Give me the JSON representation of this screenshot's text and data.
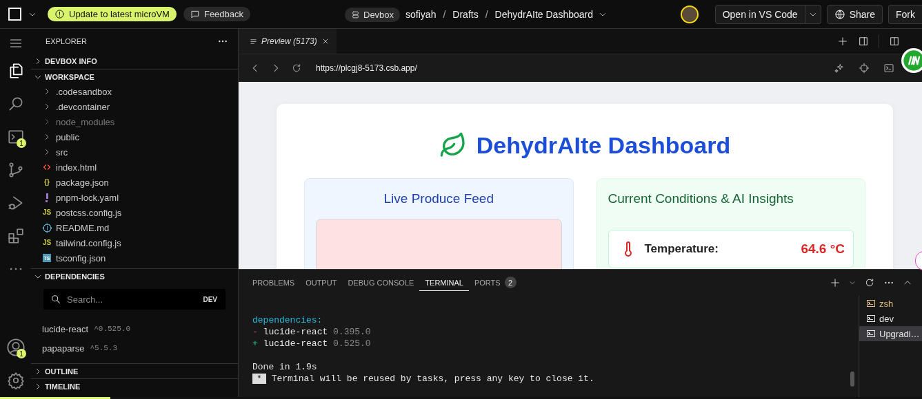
{
  "top_bar": {
    "update_badge": "Update to latest microVM",
    "feedback": "Feedback",
    "devbox": "Devbox",
    "breadcrumb": [
      "sofiyah",
      "Drafts",
      "DehydrAIte Dashboard"
    ],
    "separator": "/",
    "open_button": "Open in VS Code",
    "share_button": "Share",
    "fork_button": "Fork"
  },
  "activity_bar": [
    {
      "kind": "explorer",
      "selected": true
    },
    {
      "kind": "search",
      "selected": false
    },
    {
      "kind": "terminal",
      "selected": false,
      "badge": "1"
    },
    {
      "kind": "source-control",
      "selected": false
    },
    {
      "kind": "run-debug",
      "selected": false
    },
    {
      "kind": "extensions",
      "selected": false
    },
    {
      "kind": "more",
      "selected": false
    }
  ],
  "activity_bottom": [
    {
      "kind": "account",
      "badge": "1"
    },
    {
      "kind": "settings"
    }
  ],
  "sidebar": {
    "title": "EXPLORER",
    "sections": [
      {
        "title": "DEVBOX INFO",
        "expanded": false
      },
      {
        "title": "WORKSPACE",
        "expanded": true
      }
    ],
    "tree": [
      {
        "name": ".codesandbox",
        "kind": "folder",
        "ignored": false
      },
      {
        "name": ".devcontainer",
        "kind": "folder",
        "ignored": false
      },
      {
        "name": "node_modules",
        "kind": "folder",
        "ignored": true
      },
      {
        "name": "public",
        "kind": "folder",
        "ignored": false
      },
      {
        "name": "src",
        "kind": "folder",
        "ignored": false
      },
      {
        "name": "index.html",
        "kind": "html",
        "ignored": false,
        "color": "#e44d26"
      },
      {
        "name": "package.json",
        "kind": "glyph",
        "glyph": "{}",
        "ignored": false,
        "color": "#cbcb41"
      },
      {
        "name": "pnpm-lock.yaml",
        "kind": "yaml",
        "ignored": false,
        "color": "#a074c4"
      },
      {
        "name": "postcss.config.js",
        "kind": "glyph",
        "glyph": "JS",
        "ignored": false,
        "color": "#cbcb41"
      },
      {
        "name": "README.md",
        "kind": "info",
        "ignored": false,
        "color": "#519aba"
      },
      {
        "name": "tailwind.config.js",
        "kind": "glyph",
        "glyph": "JS",
        "ignored": false,
        "color": "#cbcb41"
      },
      {
        "name": "tsconfig.json",
        "kind": "ts",
        "glyph": "TS",
        "ignored": false,
        "color": "#519aba"
      }
    ],
    "dependencies": {
      "title": "DEPENDENCIES",
      "expanded": true,
      "search": {
        "placeholder": "Search...",
        "tag": "DEV"
      },
      "items": [
        {
          "name": "lucide-react",
          "version": "^0.525.0"
        },
        {
          "name": "papaparse",
          "version": "^5.5.3"
        }
      ]
    },
    "lower_sections": [
      {
        "title": "OUTLINE",
        "expanded": false
      },
      {
        "title": "TIMELINE",
        "expanded": false
      }
    ]
  },
  "editor_tab": {
    "title": "Preview (5173)"
  },
  "address_bar": {
    "url": "https://plcgj8-5173.csb.app/"
  },
  "preview": {
    "title": "DehydrAIte Dashboard",
    "feed_panel": {
      "title": "Live Produce Feed"
    },
    "insights_panel": {
      "title": "Current Conditions & AI Insights",
      "metric": {
        "label": "Temperature:",
        "value": "64.6 °C"
      }
    }
  },
  "panel": {
    "tabs": [
      {
        "label": "PROBLEMS",
        "selected": false
      },
      {
        "label": "OUTPUT",
        "selected": false
      },
      {
        "label": "DEBUG CONSOLE",
        "selected": false
      },
      {
        "label": "TERMINAL",
        "selected": true
      },
      {
        "label": "PORTS",
        "selected": false,
        "count": "2"
      }
    ],
    "terminal_lines": [
      {
        "kind": "heading",
        "text": "dependencies:"
      },
      {
        "kind": "removed",
        "sign": "-",
        "name": "lucide-react",
        "version": "0.395.0"
      },
      {
        "kind": "added",
        "sign": "+",
        "name": "lucide-react",
        "version": "0.525.0"
      },
      {
        "kind": "blank"
      },
      {
        "kind": "plain",
        "text": "Done in 1.9s"
      },
      {
        "kind": "notice",
        "marker": "*",
        "text": "Terminal will be reused by tasks, press any key to close it."
      }
    ],
    "terminals": [
      {
        "name": "zsh",
        "selected": false,
        "color": "#e5c07b"
      },
      {
        "name": "dev",
        "selected": false,
        "color": "#e6e6e6"
      },
      {
        "name": "Upgradi…",
        "selected": true,
        "color": "#e6e6e6"
      }
    ]
  },
  "status_progress": {
    "level": 0.12
  }
}
